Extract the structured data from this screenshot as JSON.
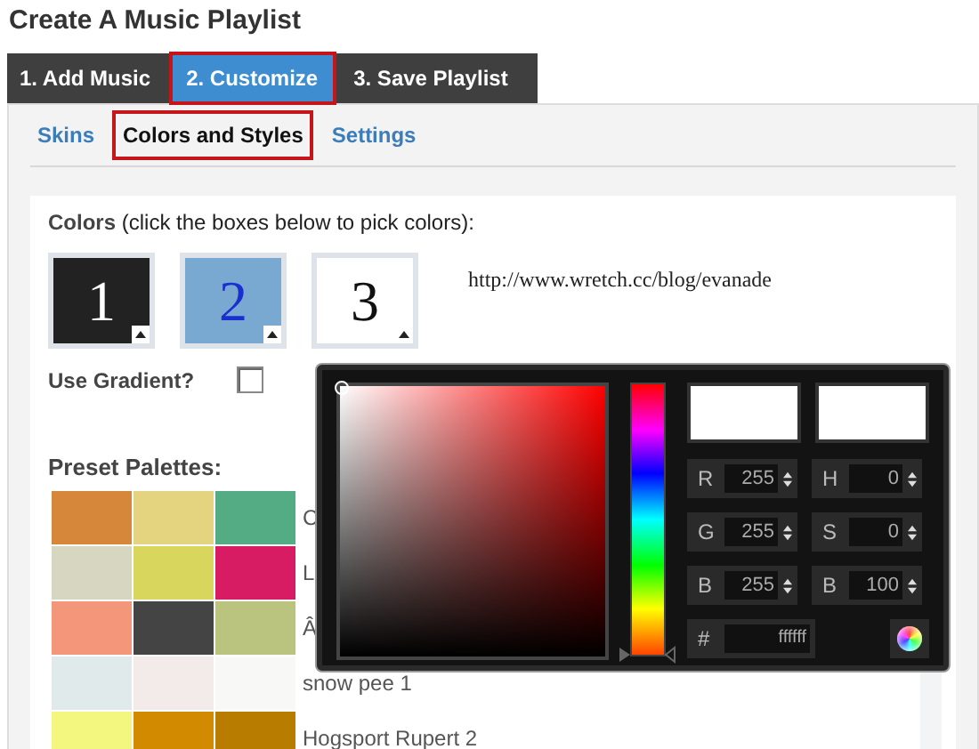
{
  "title": "Create A Music Playlist",
  "steps": [
    {
      "label": "1. Add Music",
      "selected": false
    },
    {
      "label": "2. Customize",
      "selected": true
    },
    {
      "label": "3. Save Playlist",
      "selected": false
    }
  ],
  "subtabs": [
    {
      "label": "Skins",
      "selected": false
    },
    {
      "label": "Colors and Styles",
      "selected": true
    },
    {
      "label": "Settings",
      "selected": false
    }
  ],
  "colors_heading": {
    "label": "Colors",
    "hint": "(click the boxes below to pick colors):"
  },
  "swatches": [
    {
      "number": "1",
      "color": "#222222"
    },
    {
      "number": "2",
      "color": "#79a9d1"
    },
    {
      "number": "3",
      "color": "#ffffff"
    }
  ],
  "url": "http://www.wretch.cc/blog/evanade",
  "gradient": {
    "label": "Use Gradient?",
    "checked": false
  },
  "palettes_heading": "Preset Palettes:",
  "palettes": [
    {
      "name": "C",
      "colors": [
        {
          "color": "#d6873a"
        },
        {
          "color": "#e4d47f"
        },
        {
          "color": "#53ac84"
        }
      ]
    },
    {
      "name": "L",
      "colors": [
        {
          "color": "#d7d6c0"
        },
        {
          "color": "#d8d65c"
        },
        {
          "color": "#d81c63"
        }
      ]
    },
    {
      "name": "Â",
      "colors": [
        {
          "color": "#f3967a"
        },
        {
          "color": "#444444"
        },
        {
          "color": "#bbc47f"
        }
      ]
    },
    {
      "name": "snow pee 1",
      "colors": [
        {
          "color": "#e1eaeb"
        },
        {
          "color": "#f2ebe9"
        },
        {
          "color": "#f8f8f6"
        }
      ]
    },
    {
      "name": "Hogsport Rupert 2",
      "colors": [
        {
          "color": "#f3f780"
        },
        {
          "color": "#d28a00"
        },
        {
          "color": "#b87c00"
        }
      ]
    }
  ],
  "picker": {
    "hue": {
      "level": 0
    },
    "fields": [
      {
        "label": "R",
        "value": "255"
      },
      {
        "label": "H",
        "value": "0"
      },
      {
        "label": "G",
        "value": "255"
      },
      {
        "label": "S",
        "value": "0"
      },
      {
        "label": "B",
        "value": "255"
      },
      {
        "label": "B",
        "value": "100"
      }
    ],
    "hex_label": "#",
    "hex": "ffffff"
  }
}
